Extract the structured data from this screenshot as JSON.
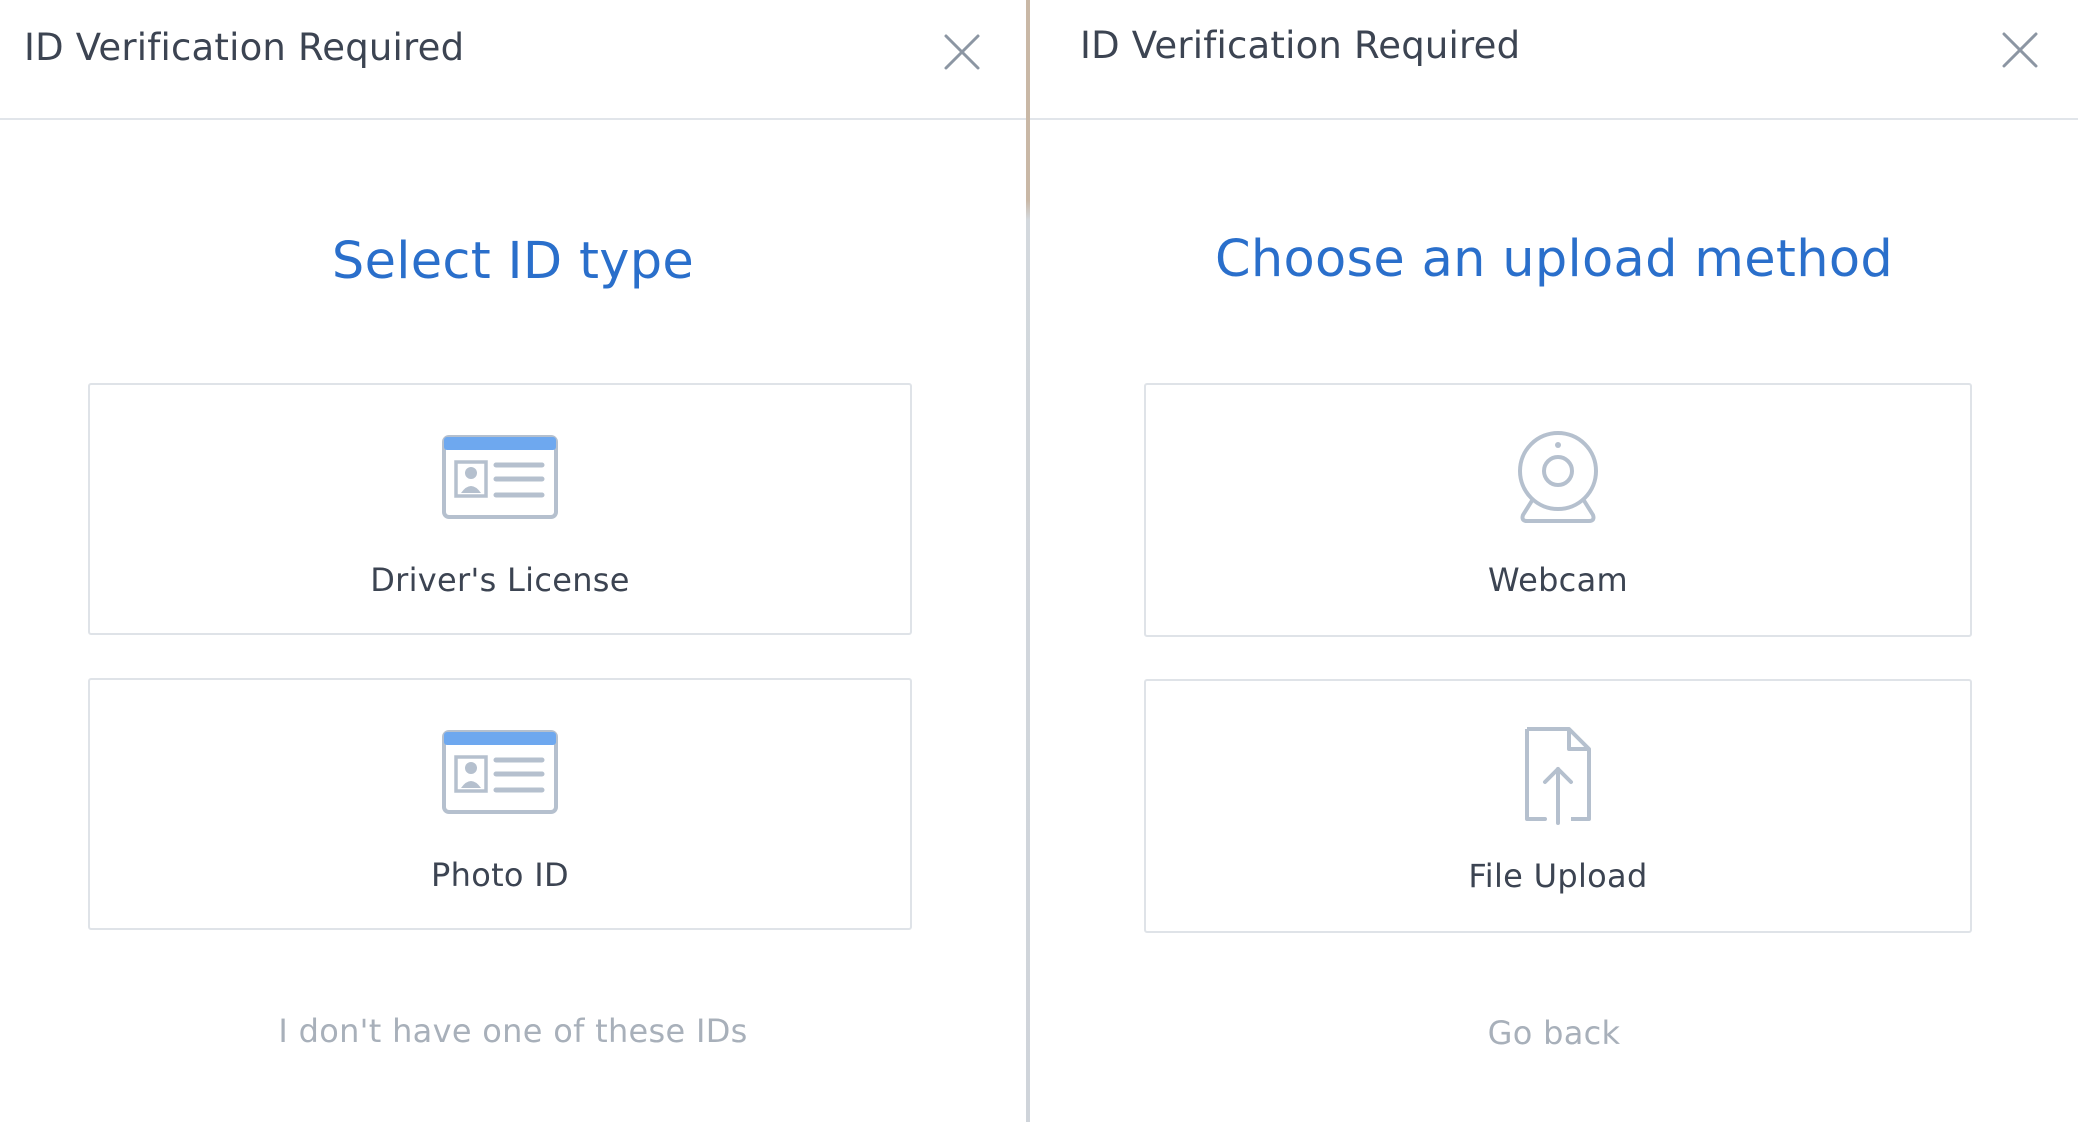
{
  "left_panel": {
    "header_title": "ID Verification Required",
    "page_title": "Select ID type",
    "options": [
      {
        "label": "Driver's License",
        "icon": "id-card-icon"
      },
      {
        "label": "Photo ID",
        "icon": "id-card-icon"
      }
    ],
    "footer_link": "I don't have one of these IDs"
  },
  "right_panel": {
    "header_title": "ID Verification Required",
    "page_title": "Choose an upload method",
    "options": [
      {
        "label": "Webcam",
        "icon": "webcam-icon"
      },
      {
        "label": "File Upload",
        "icon": "file-upload-icon"
      }
    ],
    "footer_link": "Go back"
  },
  "colors": {
    "accent_blue": "#2a6fcb",
    "text_dark": "#3c4452",
    "text_muted": "#a8b0ba",
    "icon_stroke": "#b5c0ce",
    "icon_header_blue": "#6ea8ef",
    "border": "#dfe3e8"
  }
}
